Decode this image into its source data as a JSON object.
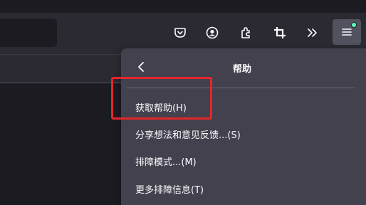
{
  "toolbar": {
    "icons": [
      "pocket-icon",
      "account-icon",
      "extensions-icon",
      "screenshot-icon",
      "overflow-chevron-icon",
      "hamburger-menu-icon"
    ]
  },
  "help_panel": {
    "title": "帮助",
    "items": [
      {
        "label": "获取帮助(H)"
      },
      {
        "label": "分享想法和意见反馈...(S)"
      },
      {
        "label": "排障模式...(M)"
      },
      {
        "label": "更多排障信息(T)"
      }
    ]
  },
  "colors": {
    "panel_bg": "#42414d",
    "toolbar_bg": "#2b2a33",
    "highlight": "#e3262a",
    "attention": "#54ffbd"
  }
}
